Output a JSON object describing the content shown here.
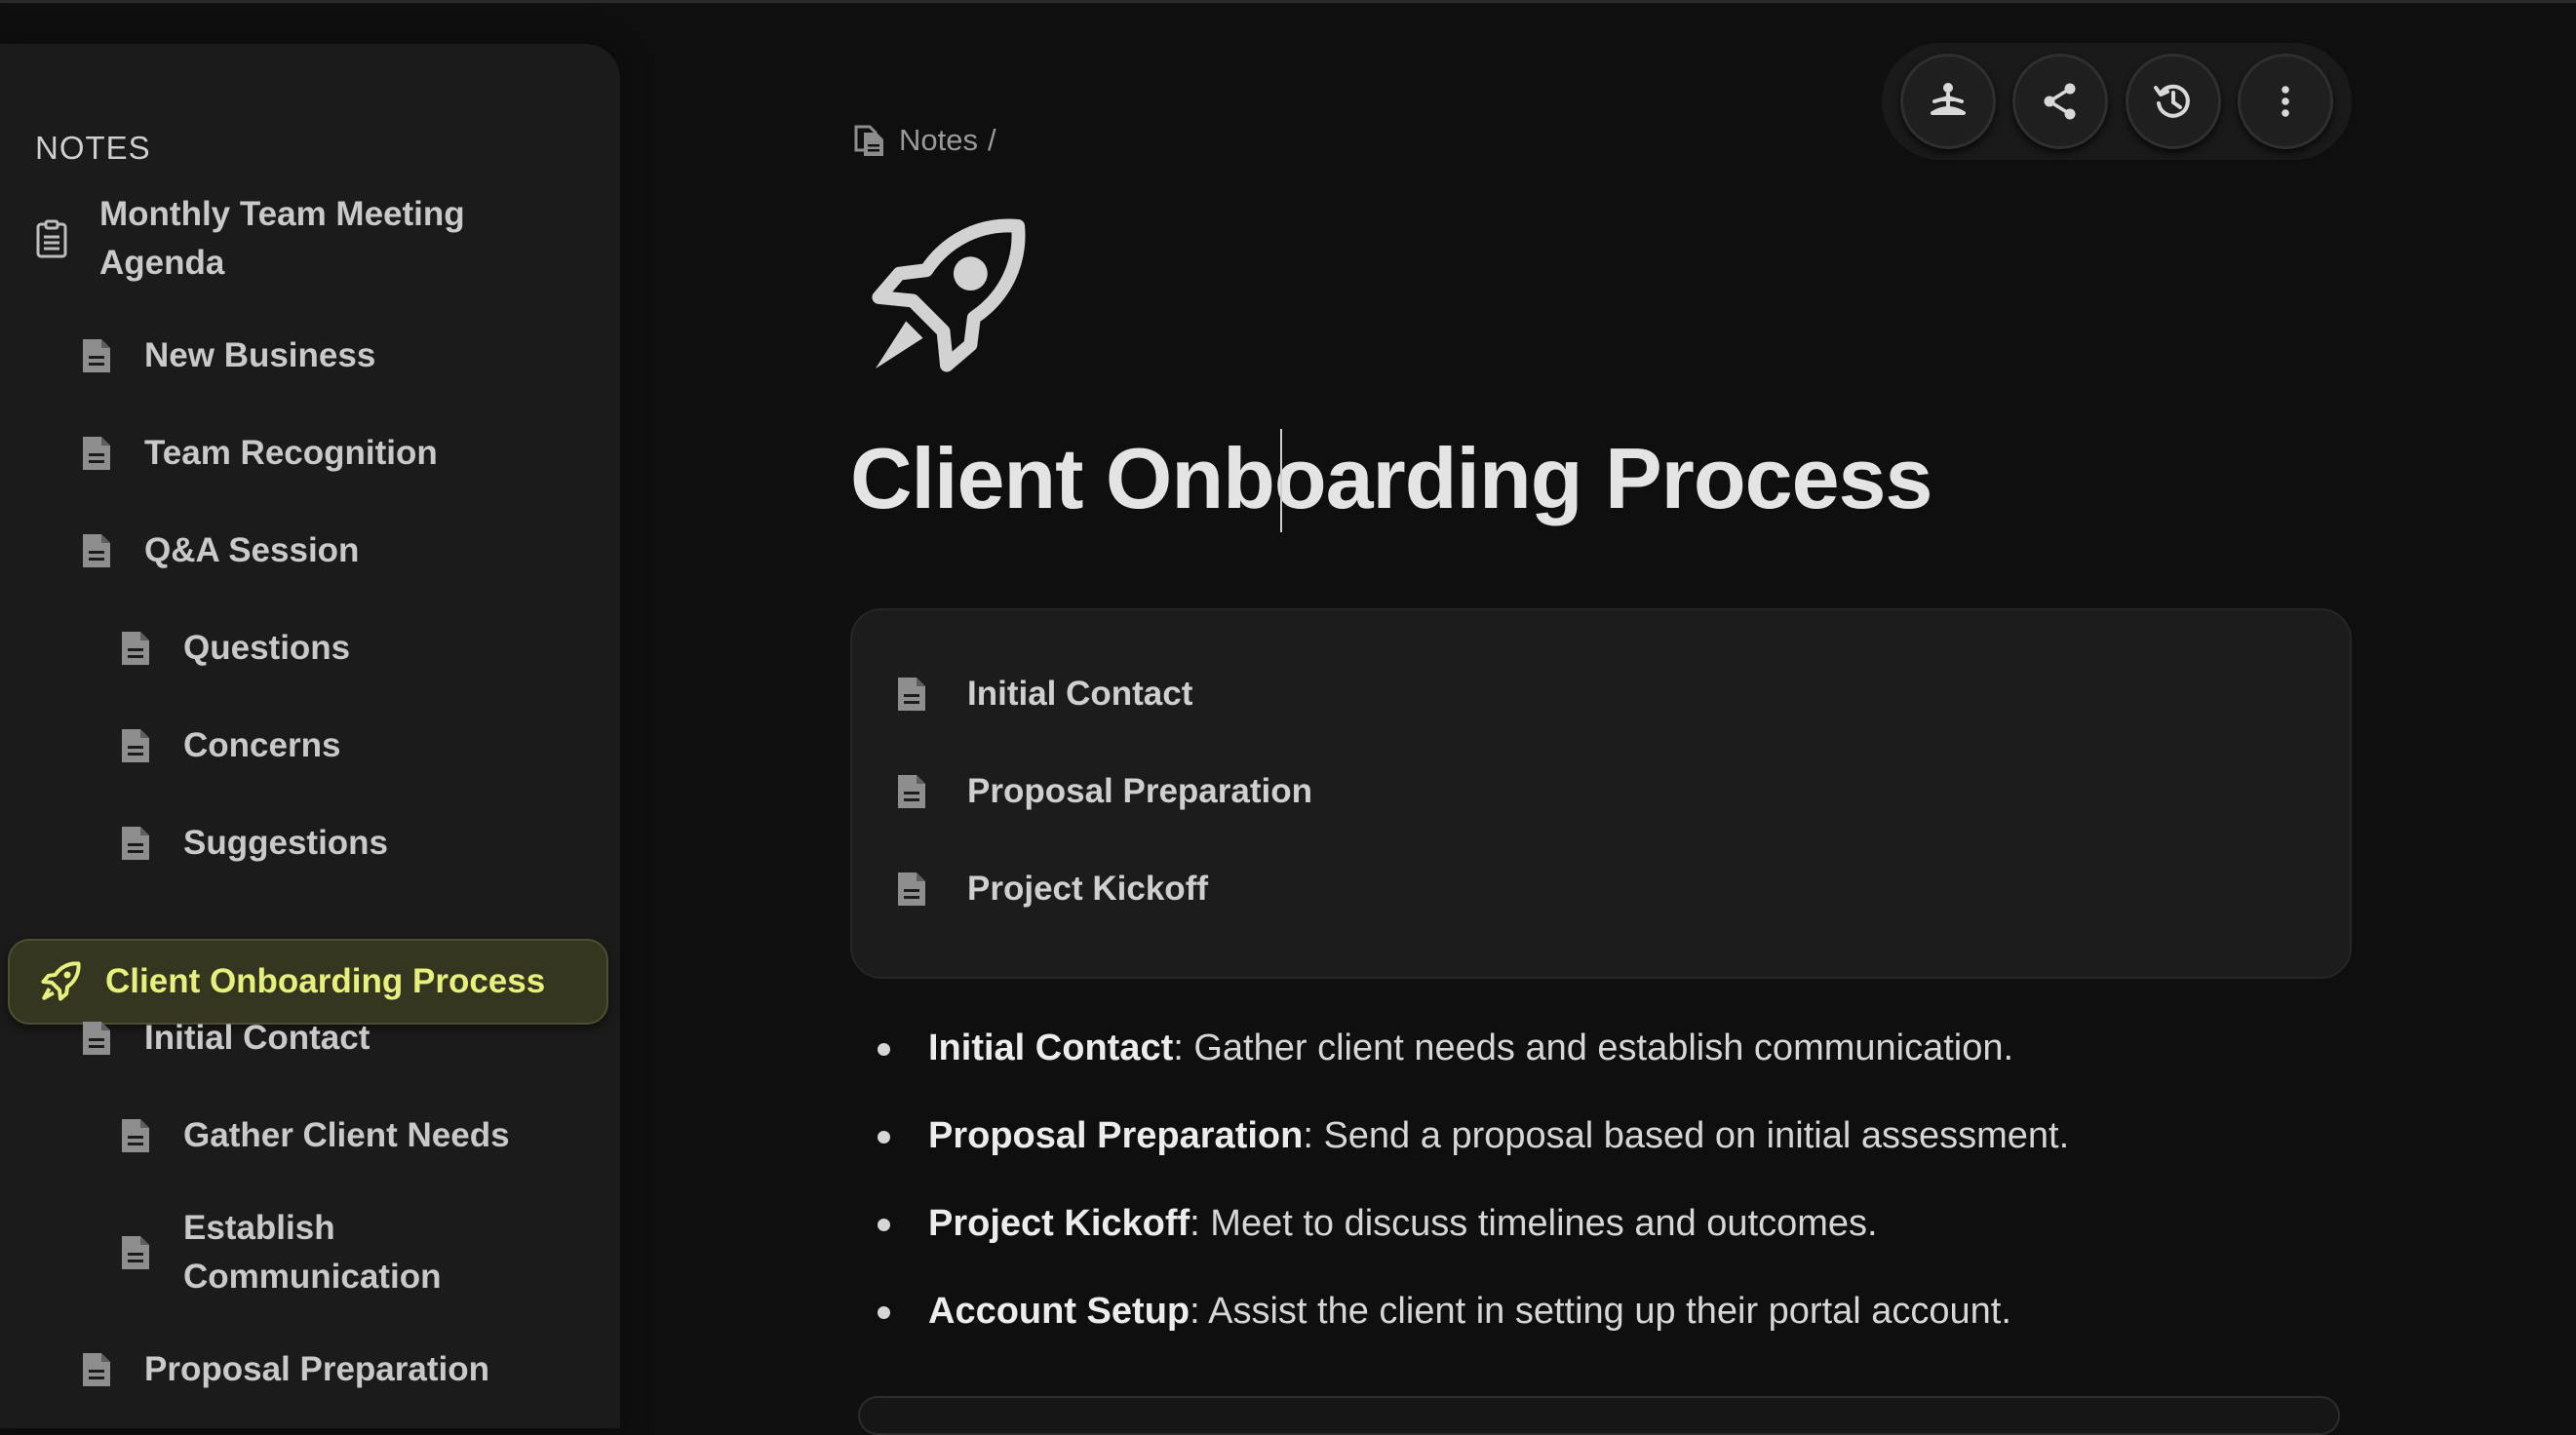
{
  "sidebar": {
    "title": "NOTES",
    "items": [
      {
        "label": "Monthly Team Meeting Agenda",
        "icon": "clipboard-icon"
      },
      {
        "label": "New Business",
        "icon": "document-icon"
      },
      {
        "label": "Team Recognition",
        "icon": "document-icon"
      },
      {
        "label": "Q&A Session",
        "icon": "document-icon"
      },
      {
        "label": "Questions",
        "icon": "document-icon"
      },
      {
        "label": "Concerns",
        "icon": "document-icon"
      },
      {
        "label": "Suggestions",
        "icon": "document-icon"
      },
      {
        "label": "Client Onboarding Process",
        "icon": "rocket-icon",
        "active": true
      },
      {
        "label": "Initial Contact",
        "icon": "document-icon"
      },
      {
        "label": "Gather Client Needs",
        "icon": "document-icon"
      },
      {
        "label": "Establish Communication",
        "icon": "document-icon"
      },
      {
        "label": "Proposal Preparation",
        "icon": "document-icon"
      }
    ]
  },
  "actions": [
    {
      "name": "zen-mode-button",
      "icon": "meditation-icon"
    },
    {
      "name": "share-button",
      "icon": "share-icon"
    },
    {
      "name": "history-button",
      "icon": "history-icon"
    },
    {
      "name": "more-button",
      "icon": "more-vertical-icon"
    }
  ],
  "breadcrumb": {
    "root": "Notes",
    "separator": "/"
  },
  "page": {
    "icon": "rocket-icon",
    "title": "Client Onboarding Process",
    "subpages": [
      "Initial Contact",
      "Proposal Preparation",
      "Project Kickoff"
    ],
    "bullets": [
      {
        "term": "Initial Contact",
        "text": ": Gather client needs and establish communication."
      },
      {
        "term": "Proposal Preparation",
        "text": ": Send a proposal based on initial assessment."
      },
      {
        "term": "Project Kickoff",
        "text": ": Meet to discuss timelines and outcomes."
      },
      {
        "term": "Account Setup",
        "text": ": Assist the client in setting up their portal account."
      }
    ]
  },
  "colors": {
    "accent": "#e6f07c",
    "active_bg": "#34361f",
    "background": "#0f0f10",
    "sidebar": "#1b1b1c"
  }
}
